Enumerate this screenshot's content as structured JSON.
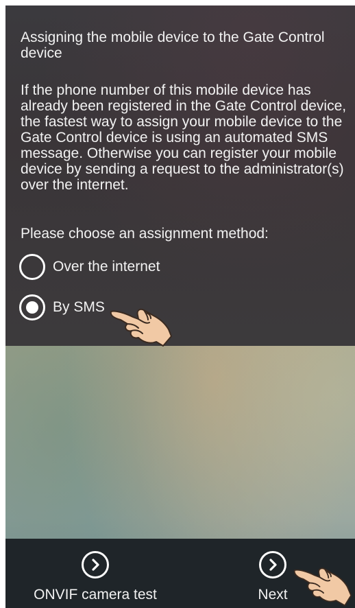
{
  "screen": {
    "title": "Assigning the mobile device to the Gate Control device",
    "description": "If the phone number of this mobile device has already been registered in the Gate Control device, the fastest way to assign your mobile device to the Gate Control device is using an automated SMS message. Otherwise you can register your mobile device by sending a request to the administrator(s) over the internet.",
    "prompt": "Please choose an assignment method:",
    "options": [
      {
        "label": "Over the internet",
        "selected": false
      },
      {
        "label": "By SMS",
        "selected": true
      }
    ]
  },
  "bottom_bar": {
    "left_button": {
      "label": "ONVIF camera test",
      "icon": "chevron-right-circle-icon"
    },
    "right_button": {
      "label": "Next",
      "icon": "chevron-right-circle-icon"
    }
  },
  "annotations": {
    "pointer_icon": "pointing-hand-icon"
  }
}
